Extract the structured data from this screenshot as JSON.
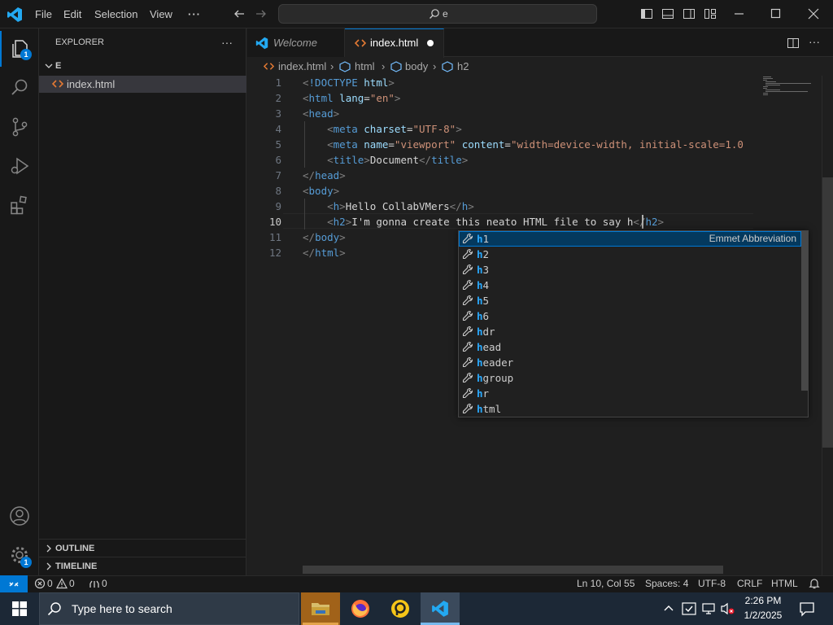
{
  "menu": {
    "file": "File",
    "edit": "Edit",
    "selection": "Selection",
    "view": "View",
    "more": "···"
  },
  "command_center": {
    "text": "e"
  },
  "activity": {
    "explorer_badge": "1",
    "settings_badge": "1"
  },
  "sidebar": {
    "title": "EXPLORER",
    "folder": "E",
    "file": "index.html",
    "outline": "OUTLINE",
    "timeline": "TIMELINE"
  },
  "tabs": {
    "welcome": "Welcome",
    "active": "index.html"
  },
  "breadcrumb": {
    "file": "index.html",
    "html": "html",
    "body": "body",
    "h2": "h2"
  },
  "editor": {
    "line_numbers": [
      "1",
      "2",
      "3",
      "4",
      "5",
      "6",
      "7",
      "8",
      "9",
      "10",
      "11",
      "12"
    ],
    "current_line": 10
  },
  "suggest": {
    "detail": "Emmet Abbreviation",
    "items": [
      "h1",
      "h2",
      "h3",
      "h4",
      "h5",
      "h6",
      "hdr",
      "head",
      "header",
      "hgroup",
      "hr",
      "html"
    ]
  },
  "status": {
    "errors": "0",
    "warnings": "0",
    "ports": "0",
    "position": "Ln 10, Col 55",
    "spaces": "Spaces: 4",
    "encoding": "UTF-8",
    "eol": "CRLF",
    "language": "HTML"
  },
  "taskbar": {
    "search_placeholder": "Type here to search",
    "time": "2:26 PM",
    "date": "1/2/2025"
  },
  "colors": {
    "accent": "#0078d4",
    "tag": "#569cd6",
    "attr": "#9cdcfe",
    "string": "#ce9178",
    "match": "#2aaaff"
  }
}
